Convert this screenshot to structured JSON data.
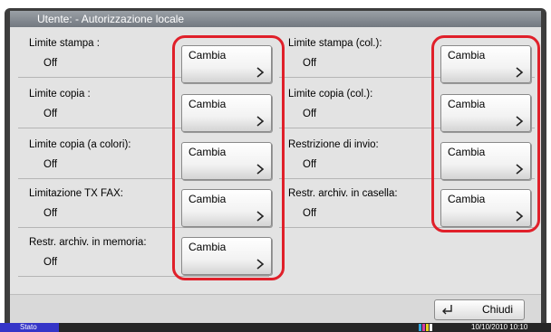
{
  "window": {
    "title": "Utente: - Autorizzazione locale"
  },
  "left_rows": [
    {
      "label": "Limite stampa :",
      "value": "Off",
      "button": "Cambia"
    },
    {
      "label": "Limite copia :",
      "value": "Off",
      "button": "Cambia"
    },
    {
      "label": "Limite copia (a colori):",
      "value": "Off",
      "button": "Cambia"
    },
    {
      "label": "Limitazione TX FAX:",
      "value": "Off",
      "button": "Cambia"
    },
    {
      "label": "Restr. archiv. in memoria:",
      "value": "Off",
      "button": "Cambia"
    }
  ],
  "right_rows": [
    {
      "label": "Limite stampa (col.):",
      "value": "Off",
      "button": "Cambia"
    },
    {
      "label": "Limite copia (col.):",
      "value": "Off",
      "button": "Cambia"
    },
    {
      "label": "Restrizione di invio:",
      "value": "Off",
      "button": "Cambia"
    },
    {
      "label": "Restr. archiv. in casella:",
      "value": "Off",
      "button": "Cambia"
    }
  ],
  "footer": {
    "close_label": "Chiudi"
  },
  "status_bar": {
    "status_label": "Stato",
    "datetime": "10/10/2010  10:10"
  },
  "colors": {
    "highlight": "#e0202a",
    "status_blue": "#3535c8",
    "panel_bg": "#e3e3e3",
    "frame": "#3d3d3d"
  },
  "icons": {
    "button_arrow": "chevron-right-icon",
    "close": "return-arrow-icon",
    "toner": "toner-level-icon"
  }
}
